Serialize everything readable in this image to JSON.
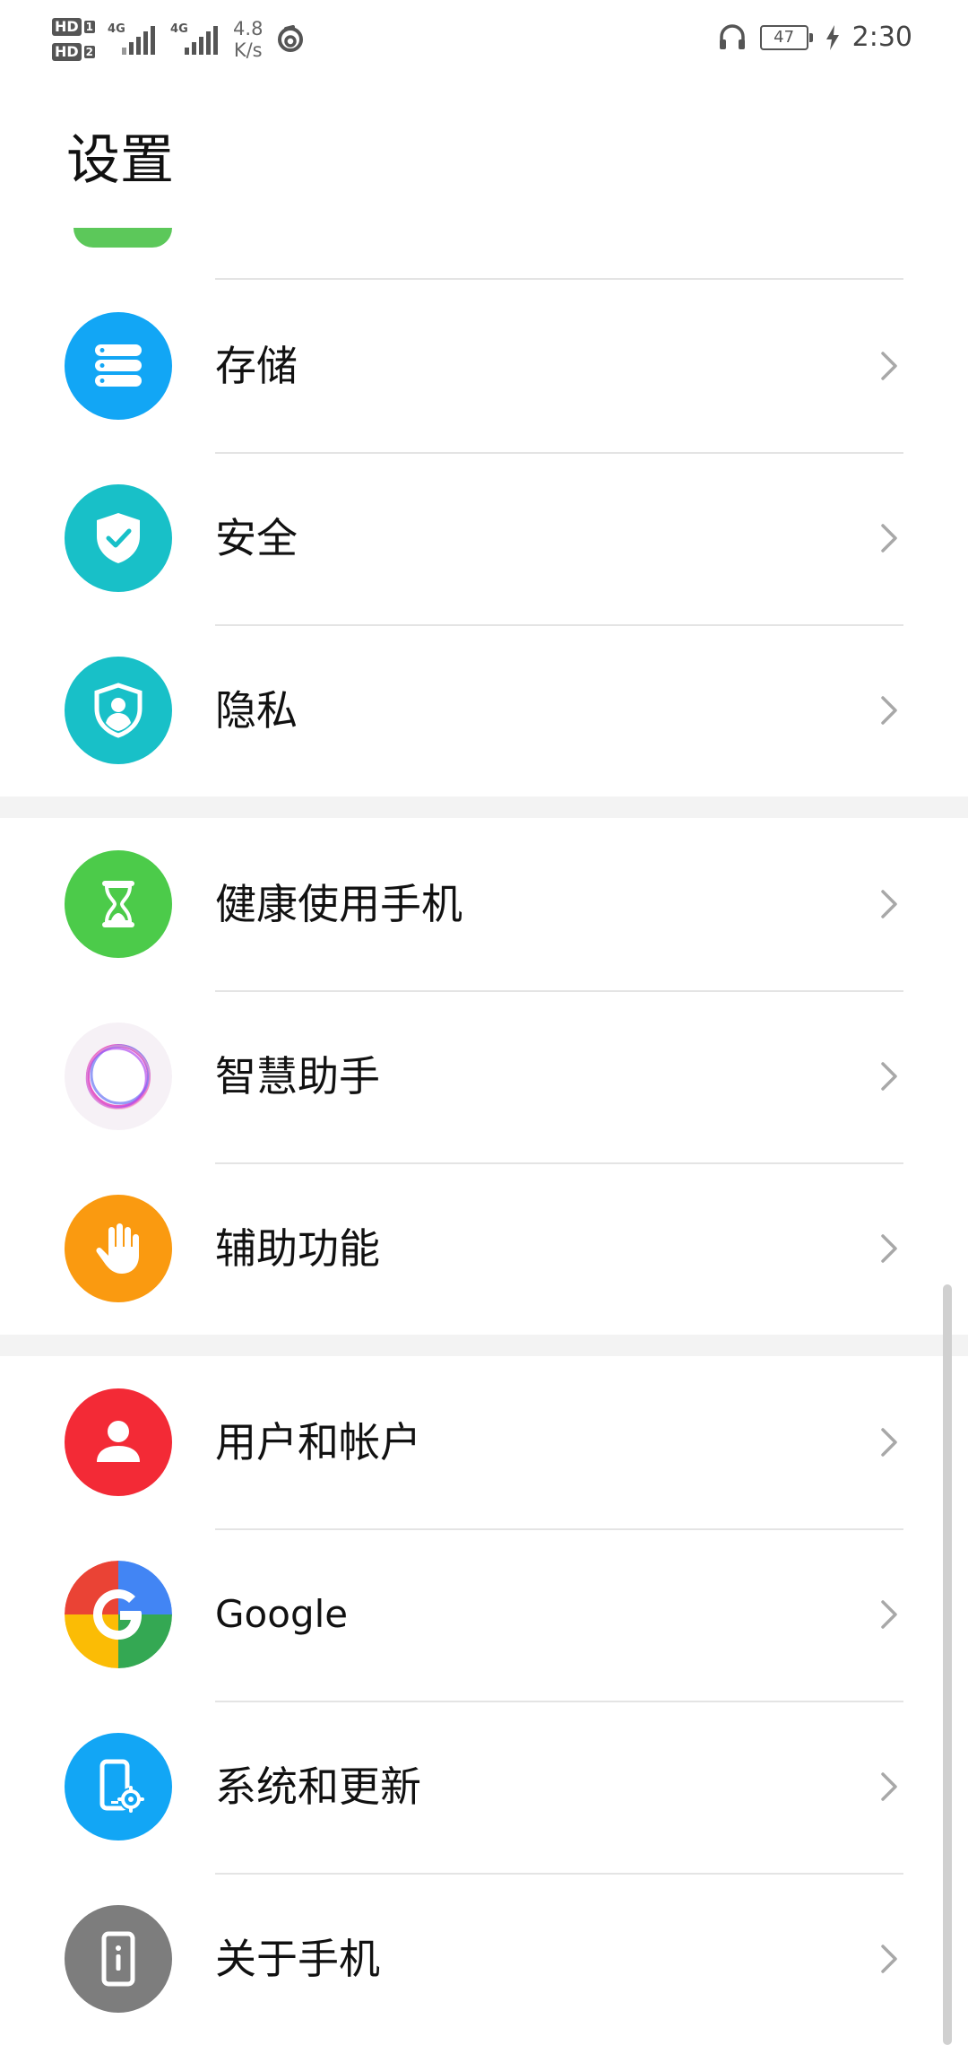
{
  "status_bar": {
    "sim1": "HD",
    "sim1_num": "1",
    "sim2": "HD",
    "sim2_num": "2",
    "net1": "4G",
    "net2": "4G",
    "speed_value": "4.8",
    "speed_unit": "K/s",
    "battery": "47",
    "time": "2:30"
  },
  "page": {
    "title": "设置"
  },
  "items": [
    {
      "label": "存储",
      "icon": "storage-icon",
      "color": "#12a6f5"
    },
    {
      "label": "安全",
      "icon": "security-shield-icon",
      "color": "#18c0c8"
    },
    {
      "label": "隐私",
      "icon": "privacy-icon",
      "color": "#18c0c8"
    },
    {
      "label": "健康使用手机",
      "icon": "hourglass-icon",
      "color": "#4ccb4a"
    },
    {
      "label": "智慧助手",
      "icon": "assistant-ring-icon",
      "color": "#f6f1f6"
    },
    {
      "label": "辅助功能",
      "icon": "hand-icon",
      "color": "#fa9a10"
    },
    {
      "label": "用户和帐户",
      "icon": "user-icon",
      "color": "#f32a36"
    },
    {
      "label": "Google",
      "icon": "google-icon",
      "color": "#4285f4"
    },
    {
      "label": "系统和更新",
      "icon": "system-update-icon",
      "color": "#12a6f5"
    },
    {
      "label": "关于手机",
      "icon": "about-phone-icon",
      "color": "#7d7d7d"
    }
  ]
}
